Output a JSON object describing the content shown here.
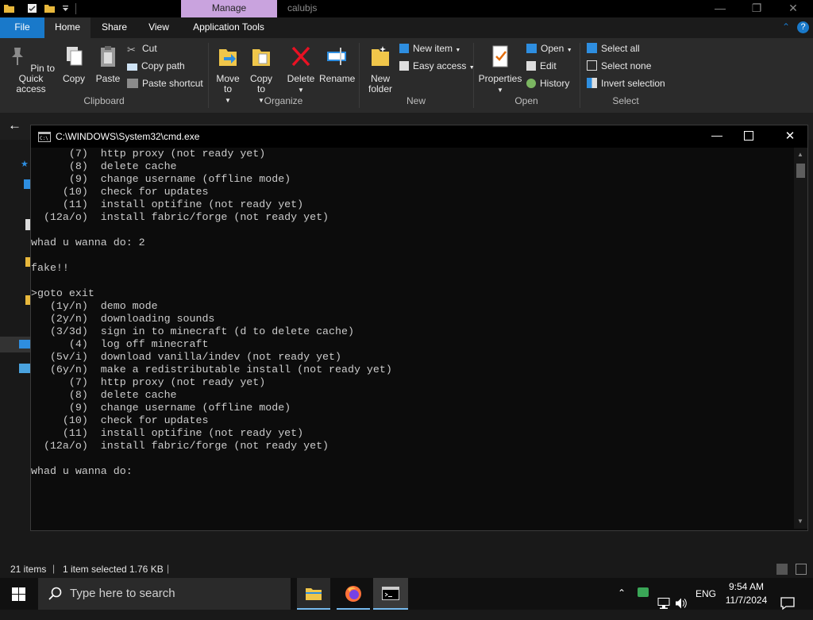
{
  "titlebar": {
    "manage_label": "Manage",
    "window_title": "calubjs"
  },
  "ribbon_tabs": {
    "file": "File",
    "home": "Home",
    "share": "Share",
    "view": "View",
    "application_tools": "Application Tools"
  },
  "ribbon": {
    "clipboard": {
      "pin_label": "Pin to Quick access",
      "copy_label": "Copy",
      "paste_label": "Paste",
      "cut_label": "Cut",
      "copy_path_label": "Copy path",
      "paste_shortcut_label": "Paste shortcut",
      "group_label": "Clipboard"
    },
    "organize": {
      "move_to_label": "Move to",
      "copy_to_label": "Copy to",
      "delete_label": "Delete",
      "rename_label": "Rename",
      "group_label": "Organize"
    },
    "new": {
      "new_folder_label": "New folder",
      "new_item_label": "New item",
      "easy_access_label": "Easy access",
      "group_label": "New"
    },
    "open": {
      "properties_label": "Properties",
      "open_label": "Open",
      "edit_label": "Edit",
      "history_label": "History",
      "group_label": "Open"
    },
    "select": {
      "select_all_label": "Select all",
      "select_none_label": "Select none",
      "invert_label": "Invert selection",
      "group_label": "Select"
    }
  },
  "cmd": {
    "title": "C:\\WINDOWS\\System32\\cmd.exe",
    "lines": [
      "      (7)  http proxy (not ready yet)",
      "      (8)  delete cache",
      "      (9)  change username (offline mode)",
      "     (10)  check for updates",
      "     (11)  install optifine (not ready yet)",
      "  (12a/o)  install fabric/forge (not ready yet)",
      "",
      "whad u wanna do: 2",
      "",
      "fake!!",
      "",
      ">goto exit",
      "   (1y/n)  demo mode",
      "   (2y/n)  downloading sounds",
      "   (3/3d)  sign in to minecraft (d to delete cache)",
      "      (4)  log off minecraft",
      "   (5v/i)  download vanilla/indev (not ready yet)",
      "   (6y/n)  make a redistributable install (not ready yet)",
      "      (7)  http proxy (not ready yet)",
      "      (8)  delete cache",
      "      (9)  change username (offline mode)",
      "     (10)  check for updates",
      "     (11)  install optifine (not ready yet)",
      "  (12a/o)  install fabric/forge (not ready yet)",
      "",
      "whad u wanna do:"
    ]
  },
  "statusbar": {
    "item_count": "21 items",
    "selection": "1 item selected",
    "size": "1.76 KB"
  },
  "taskbar": {
    "search_placeholder": "Type here to search",
    "language": "ENG",
    "time": "9:54 AM",
    "date": "11/7/2024"
  },
  "colors": {
    "accent": "#1979ca",
    "manage_tab": "#c9a3de",
    "cmd_background": "#0c0c0c",
    "cmd_text": "#cccccc"
  }
}
